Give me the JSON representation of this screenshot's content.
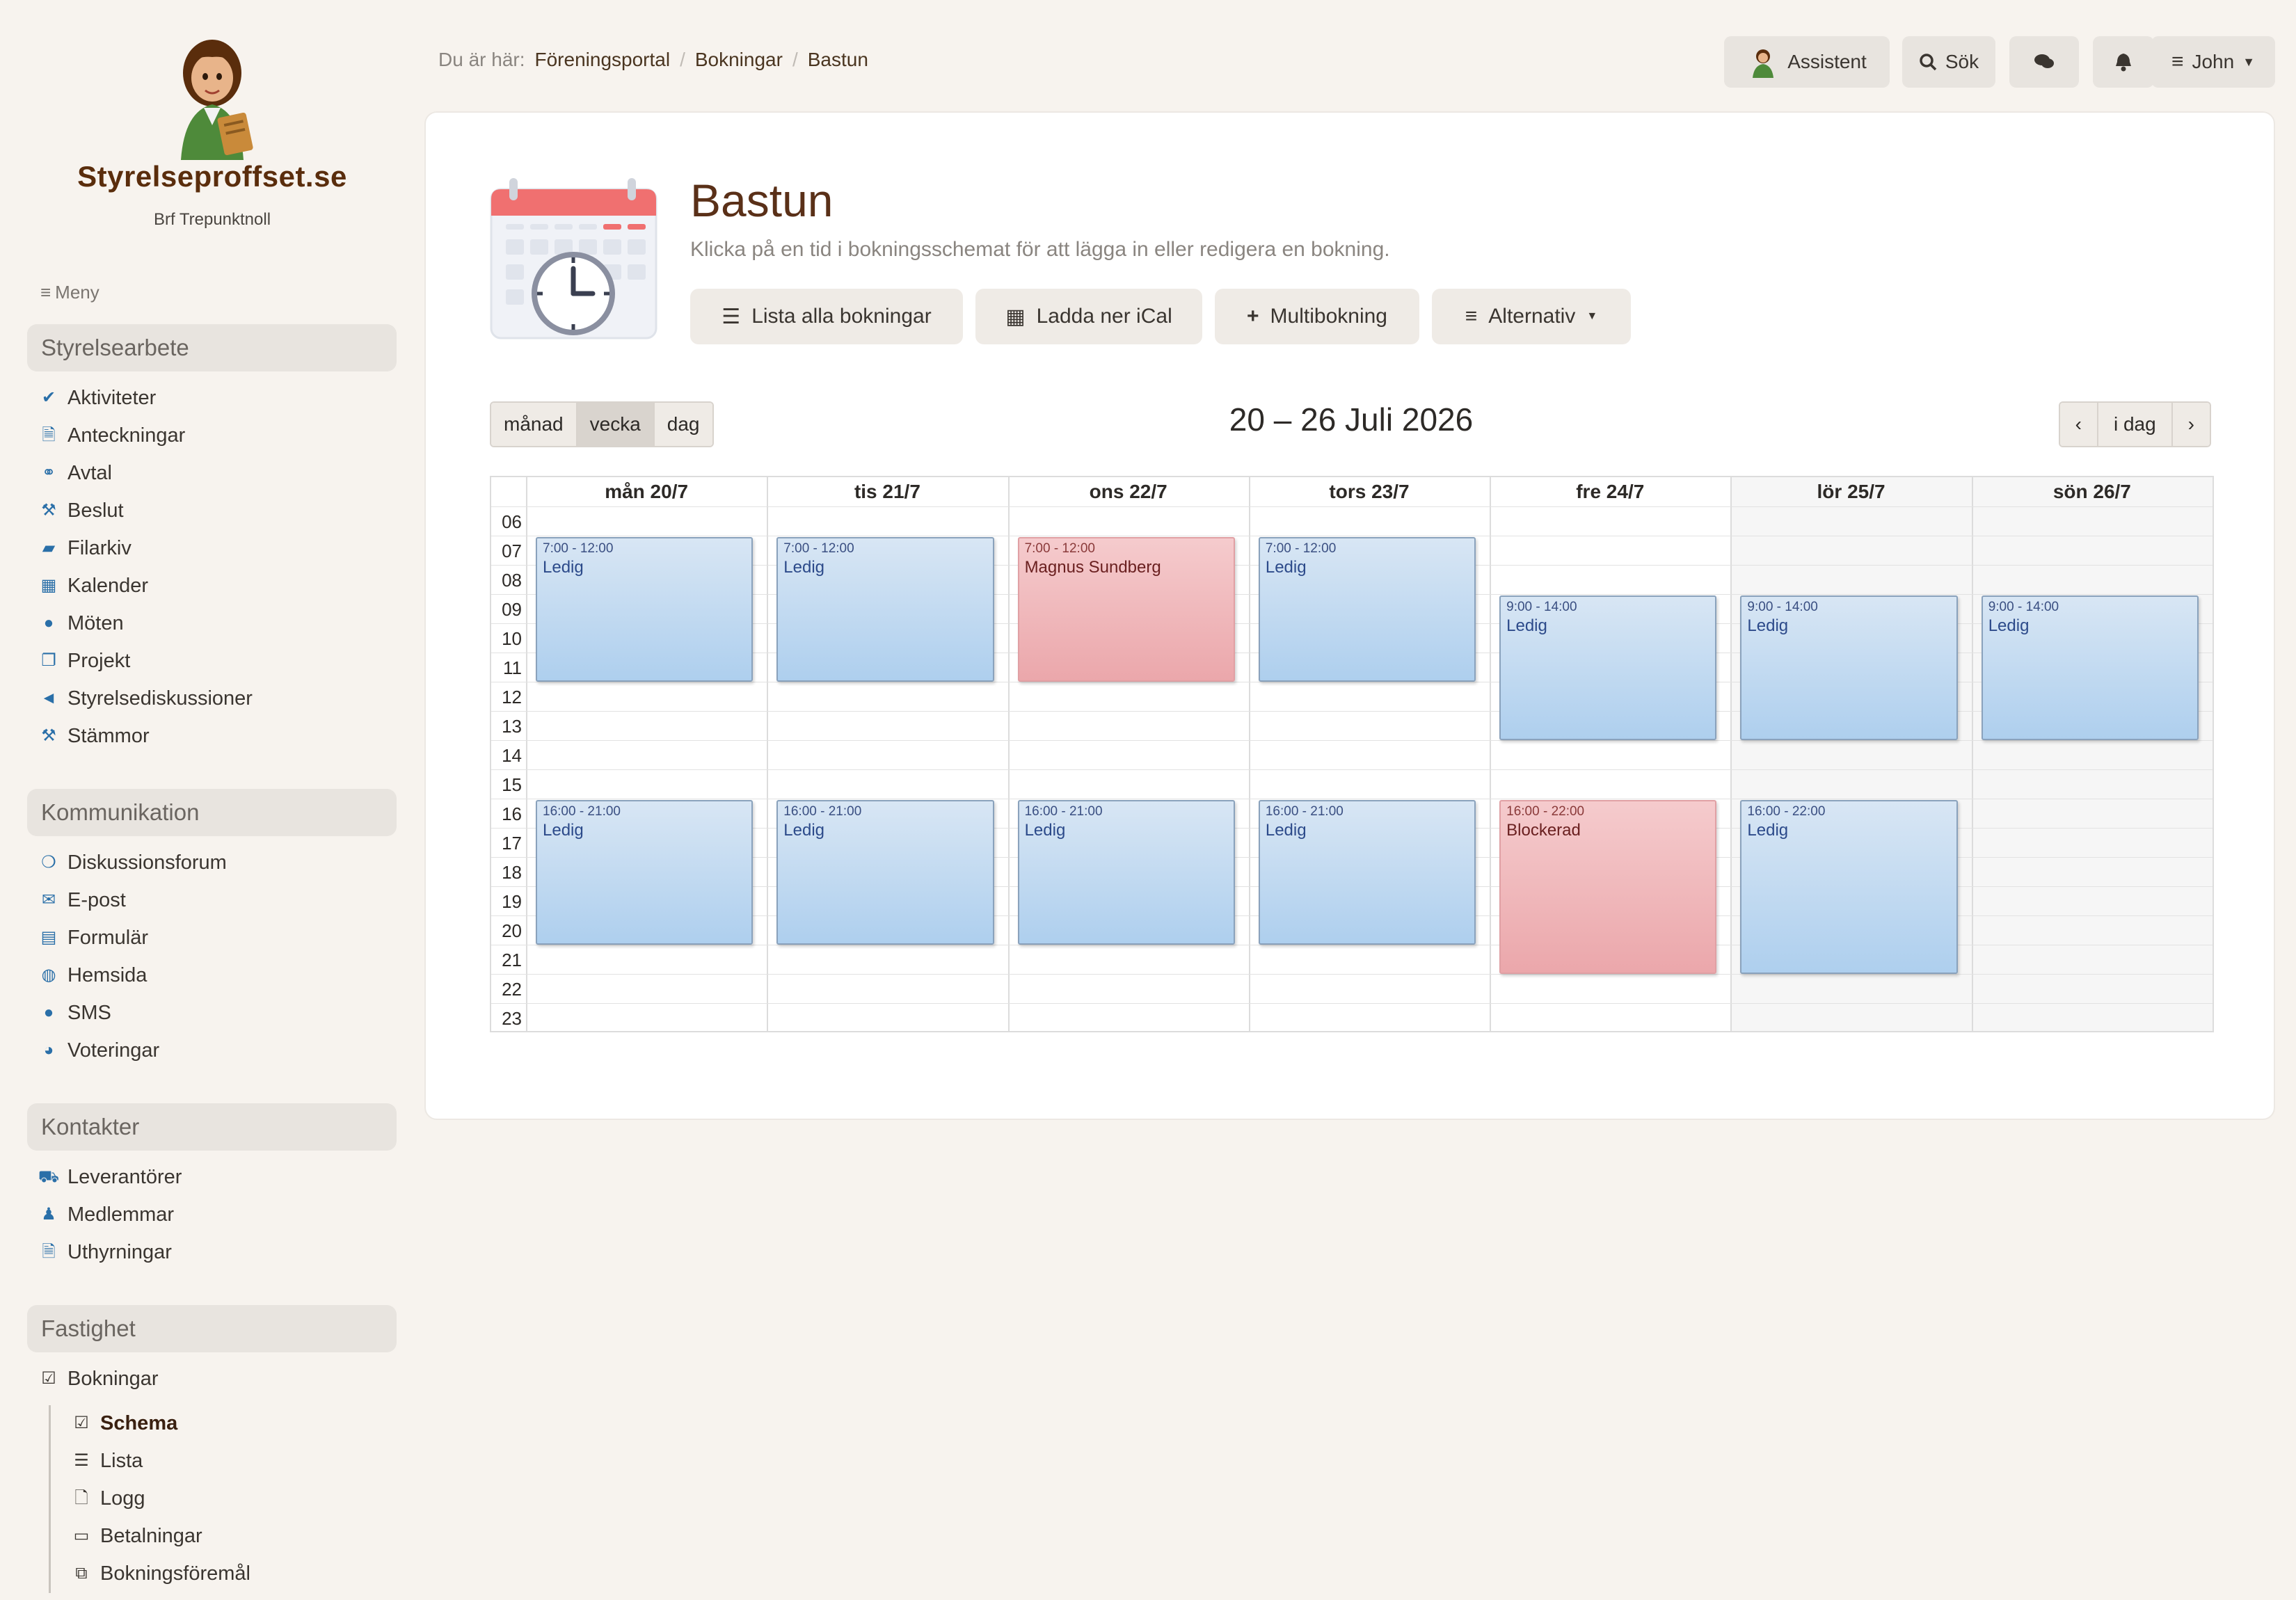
{
  "brand": {
    "title": "Styrelseproffset.se",
    "subtitle": "Brf Trepunktnoll"
  },
  "sidebar": {
    "menu_label": "Meny",
    "sections": [
      {
        "title": "Styrelsearbete",
        "items": [
          {
            "label": "Aktiviteter",
            "icon": "check-icon"
          },
          {
            "label": "Anteckningar",
            "icon": "file-icon"
          },
          {
            "label": "Avtal",
            "icon": "handshake-icon"
          },
          {
            "label": "Beslut",
            "icon": "gavel-icon"
          },
          {
            "label": "Filarkiv",
            "icon": "folder-icon"
          },
          {
            "label": "Kalender",
            "icon": "calendar-icon"
          },
          {
            "label": "Möten",
            "icon": "comment-icon"
          },
          {
            "label": "Projekt",
            "icon": "copy-icon"
          },
          {
            "label": "Styrelsediskussioner",
            "icon": "bullhorn-icon"
          },
          {
            "label": "Stämmor",
            "icon": "gavel-icon"
          }
        ]
      },
      {
        "title": "Kommunikation",
        "items": [
          {
            "label": "Diskussionsforum",
            "icon": "comments-icon"
          },
          {
            "label": "E-post",
            "icon": "envelope-icon"
          },
          {
            "label": "Formulär",
            "icon": "form-icon"
          },
          {
            "label": "Hemsida",
            "icon": "globe-icon"
          },
          {
            "label": "SMS",
            "icon": "comment-icon"
          },
          {
            "label": "Voteringar",
            "icon": "pie-chart-icon"
          }
        ]
      },
      {
        "title": "Kontakter",
        "items": [
          {
            "label": "Leverantörer",
            "icon": "cart-icon"
          },
          {
            "label": "Medlemmar",
            "icon": "user-icon"
          },
          {
            "label": "Uthyrningar",
            "icon": "file-icon"
          }
        ]
      },
      {
        "title": "Fastighet",
        "items": [
          {
            "label": "Bokningar",
            "icon": "check-square-icon"
          }
        ],
        "subitems": [
          {
            "label": "Schema",
            "icon": "check-square-icon",
            "active": true
          },
          {
            "label": "Lista",
            "icon": "list-icon"
          },
          {
            "label": "Logg",
            "icon": "file-icon"
          },
          {
            "label": "Betalningar",
            "icon": "credit-card-icon"
          },
          {
            "label": "Bokningsföremål",
            "icon": "play-square-icon"
          }
        ]
      }
    ]
  },
  "breadcrumb": {
    "prefix": "Du är här:",
    "items": [
      "Föreningsportal",
      "Bokningar",
      "Bastun"
    ]
  },
  "topbar": {
    "assistant": "Assistent",
    "search": "Sök",
    "user": "John"
  },
  "page": {
    "title": "Bastun",
    "description": "Klicka på en tid i bokningsschemat för att lägga in eller redigera en bokning.",
    "actions": [
      "Lista alla bokningar",
      "Ladda ner iCal",
      "Multibokning",
      "Alternativ"
    ]
  },
  "calendar": {
    "views": [
      "månad",
      "vecka",
      "dag"
    ],
    "active_view": "vecka",
    "range": "20 – 26 Juli 2026",
    "today": "i dag",
    "days": [
      "mån 20/7",
      "tis 21/7",
      "ons 22/7",
      "tors 23/7",
      "fre 24/7",
      "lör 25/7",
      "sön 26/7"
    ],
    "hours": [
      "06",
      "07",
      "08",
      "09",
      "10",
      "11",
      "12",
      "13",
      "14",
      "15",
      "16",
      "17",
      "18",
      "19",
      "20",
      "21",
      "22",
      "23"
    ],
    "events": [
      {
        "day": 0,
        "start": 7,
        "end": 12,
        "time": "7:00 - 12:00",
        "label": "Ledig",
        "status": "free"
      },
      {
        "day": 1,
        "start": 7,
        "end": 12,
        "time": "7:00 - 12:00",
        "label": "Ledig",
        "status": "free"
      },
      {
        "day": 2,
        "start": 7,
        "end": 12,
        "time": "7:00 - 12:00",
        "label": "Magnus Sundberg",
        "status": "booked"
      },
      {
        "day": 3,
        "start": 7,
        "end": 12,
        "time": "7:00 - 12:00",
        "label": "Ledig",
        "status": "free"
      },
      {
        "day": 4,
        "start": 9,
        "end": 14,
        "time": "9:00 - 14:00",
        "label": "Ledig",
        "status": "free"
      },
      {
        "day": 5,
        "start": 9,
        "end": 14,
        "time": "9:00 - 14:00",
        "label": "Ledig",
        "status": "free"
      },
      {
        "day": 6,
        "start": 9,
        "end": 14,
        "time": "9:00 - 14:00",
        "label": "Ledig",
        "status": "free"
      },
      {
        "day": 0,
        "start": 16,
        "end": 21,
        "time": "16:00 - 21:00",
        "label": "Ledig",
        "status": "free"
      },
      {
        "day": 1,
        "start": 16,
        "end": 21,
        "time": "16:00 - 21:00",
        "label": "Ledig",
        "status": "free"
      },
      {
        "day": 2,
        "start": 16,
        "end": 21,
        "time": "16:00 - 21:00",
        "label": "Ledig",
        "status": "free"
      },
      {
        "day": 3,
        "start": 16,
        "end": 21,
        "time": "16:00 - 21:00",
        "label": "Ledig",
        "status": "free"
      },
      {
        "day": 4,
        "start": 16,
        "end": 22,
        "time": "16:00 - 22:00",
        "label": "Blockerad",
        "status": "booked"
      },
      {
        "day": 5,
        "start": 16,
        "end": 22,
        "time": "16:00 - 22:00",
        "label": "Ledig",
        "status": "free"
      }
    ]
  },
  "colors": {
    "brand": "#5a2d0c",
    "free": "#aecfee",
    "booked": "#eba7ab",
    "icon_blue": "#2a6fa8"
  }
}
